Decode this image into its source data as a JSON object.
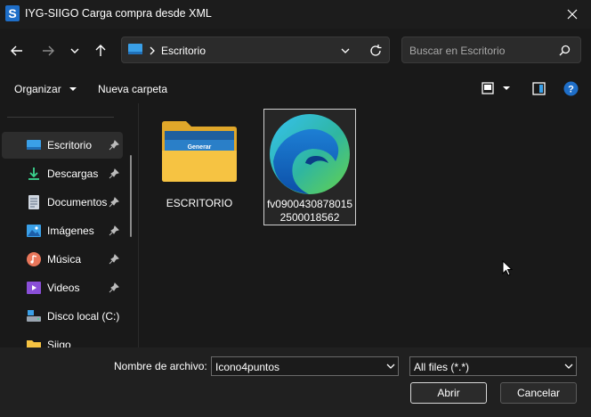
{
  "window": {
    "title": "IYG-SIIGO Carga compra desde XML",
    "app_icon_letter": "S"
  },
  "address_bar": {
    "path": "Escritorio"
  },
  "search": {
    "placeholder": "Buscar en Escritorio"
  },
  "toolbar": {
    "organize_label": "Organizar",
    "new_folder_label": "Nueva carpeta"
  },
  "sidebar": {
    "items": [
      {
        "label": "Escritorio",
        "icon": "desktop-icon",
        "pinned": true,
        "selected": true
      },
      {
        "label": "Descargas",
        "icon": "download-icon",
        "pinned": true
      },
      {
        "label": "Documentos",
        "icon": "document-icon",
        "pinned": true
      },
      {
        "label": "Imágenes",
        "icon": "image-icon",
        "pinned": true
      },
      {
        "label": "Música",
        "icon": "music-icon",
        "pinned": true
      },
      {
        "label": "Videos",
        "icon": "video-icon",
        "pinned": true
      },
      {
        "label": "Disco local (C:)",
        "icon": "drive-icon",
        "pinned": false
      },
      {
        "label": "Siigo",
        "icon": "folder-icon",
        "pinned": false
      }
    ]
  },
  "files": [
    {
      "name": "ESCRITORIO",
      "type": "folder",
      "thumbnail_text": "Generar"
    },
    {
      "name_line1": "fv0900430878015",
      "name_line2": "2500018562",
      "type": "edge-file",
      "selected": true
    }
  ],
  "footer": {
    "filename_label": "Nombre de archivo:",
    "filename_value": "Icono4puntos",
    "filetype_value": "All files (*.*)",
    "open_label": "Abrir",
    "cancel_label": "Cancelar"
  },
  "colors": {
    "accent": "#1e6ec8",
    "folder": "#f6c342",
    "background": "#191919"
  }
}
